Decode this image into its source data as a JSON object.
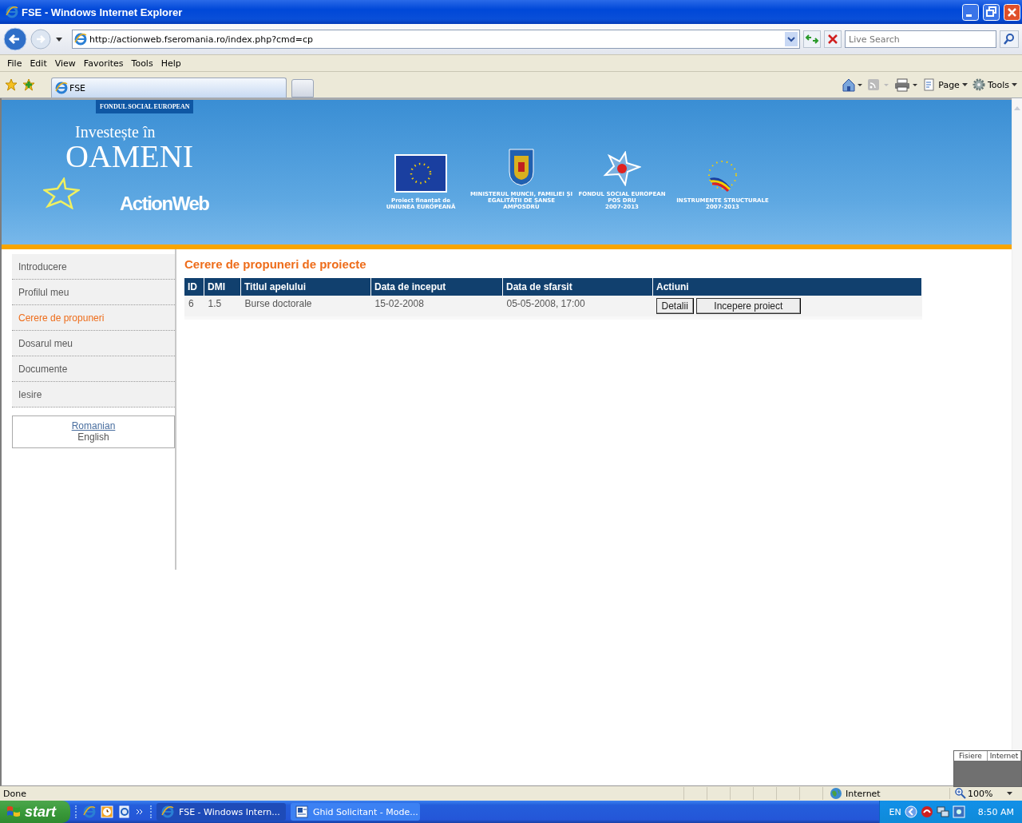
{
  "window": {
    "title": "FSE - Windows Internet Explorer"
  },
  "address_bar": {
    "url": "http://actionweb.fseromania.ro/index.php?cmd=cp",
    "search_placeholder": "Live Search"
  },
  "menu": [
    "File",
    "Edit",
    "View",
    "Favorites",
    "Tools",
    "Help"
  ],
  "tabs": [
    {
      "label": "FSE",
      "selected": true
    }
  ],
  "command_bar": [
    "Page",
    "Tools"
  ],
  "banner": {
    "tag": "FONDUL SOCIAL EUROPEAN",
    "slogan_top": "Investește în",
    "slogan_main": "OAMENI",
    "product": "ActionWeb",
    "logos": [
      {
        "kind": "eu",
        "caption": [
          "Proiect finanțat de",
          "UNIUNEA EUROPEANĂ"
        ]
      },
      {
        "kind": "crest",
        "caption": [
          "MINISTERUL MUNCII, FAMILIEI ȘI",
          "EGALITĂȚII DE ȘANSE",
          "AMPOSDRU"
        ]
      },
      {
        "kind": "fse",
        "caption": [
          "FONDUL SOCIAL EUROPEAN",
          "POS DRU",
          "2007-2013"
        ]
      },
      {
        "kind": "structural",
        "caption": [
          "INSTRUMENTE STRUCTURALE",
          "2007-2013"
        ]
      }
    ]
  },
  "sidebar": {
    "items": [
      {
        "label": "Introducere",
        "selected": false
      },
      {
        "label": "Profilul meu",
        "selected": false
      },
      {
        "label": "Cerere de propuneri",
        "selected": true
      },
      {
        "label": "Dosarul meu",
        "selected": false
      },
      {
        "label": "Documente",
        "selected": false
      },
      {
        "label": "Iesire",
        "selected": false
      }
    ],
    "languages": [
      {
        "label": "Romanian",
        "selected": false
      },
      {
        "label": "English",
        "selected": true
      }
    ]
  },
  "content": {
    "heading": "Cerere de propuneri de proiecte",
    "table": {
      "columns": [
        "ID",
        "DMI",
        "Titlul apelului",
        "Data de inceput",
        "Data de sfarsit",
        "Actiuni"
      ],
      "rows": [
        {
          "cells": [
            "6",
            "1.5",
            "Burse doctorale",
            "15-02-2008",
            "05-05-2008, 17:00"
          ],
          "actions": [
            "Detalii",
            "Incepere proiect"
          ]
        }
      ]
    }
  },
  "popup": {
    "columns": [
      "Fisiere",
      "Internet"
    ]
  },
  "status_bar": {
    "text": "Done",
    "zone": "Internet",
    "zoom": "100%"
  },
  "taskbar": {
    "start": "start",
    "tasks": [
      {
        "label": "FSE - Windows Intern...",
        "kind": "browser",
        "selected": true
      },
      {
        "label": "Ghid Solicitant - Mode...",
        "kind": "document",
        "selected": false
      }
    ],
    "language": "EN",
    "clock": "8:50 AM"
  }
}
